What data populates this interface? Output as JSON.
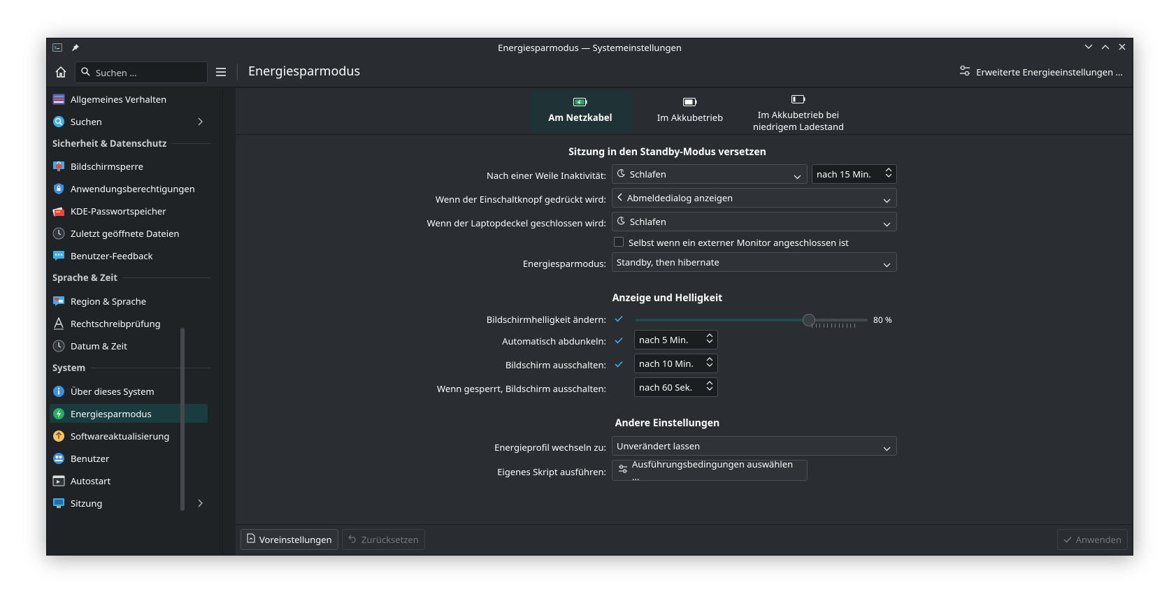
{
  "window": {
    "title": "Energiesparmodus — Systemeinstellungen"
  },
  "header": {
    "search_placeholder": "Suchen ...",
    "page_title": "Energiesparmodus",
    "advanced_button": "Erweiterte Energieeinstellungen ..."
  },
  "sidebar": {
    "items_top": [
      {
        "label": "Allgemeines Verhalten",
        "icon": "general-behavior-icon"
      },
      {
        "label": "Suchen",
        "icon": "search-icon"
      }
    ],
    "sections": [
      {
        "title": "Sicherheit & Datenschutz",
        "items": [
          {
            "label": "Bildschirmsperre",
            "icon": "screen-lock-icon"
          },
          {
            "label": "Anwendungsberechtigungen",
            "icon": "shield-icon"
          },
          {
            "label": "KDE-Passwortspeicher",
            "icon": "wallet-icon"
          },
          {
            "label": "Zuletzt geöffnete Dateien",
            "icon": "clock-icon"
          },
          {
            "label": "Benutzer-Feedback",
            "icon": "feedback-icon"
          }
        ]
      },
      {
        "title": "Sprache & Zeit",
        "items": [
          {
            "label": "Region & Sprache",
            "icon": "region-icon"
          },
          {
            "label": "Rechtschreibprüfung",
            "icon": "spellcheck-icon"
          },
          {
            "label": "Datum & Zeit",
            "icon": "clock-icon"
          }
        ]
      },
      {
        "title": "System",
        "items": [
          {
            "label": "Über dieses System",
            "icon": "info-icon"
          },
          {
            "label": "Energiesparmodus",
            "icon": "power-icon"
          },
          {
            "label": "Softwareaktualisierung",
            "icon": "update-icon"
          },
          {
            "label": "Benutzer",
            "icon": "users-icon"
          },
          {
            "label": "Autostart",
            "icon": "autostart-icon"
          },
          {
            "label": "Sitzung",
            "icon": "session-icon"
          }
        ]
      }
    ]
  },
  "tabs": [
    {
      "label": "Am Netzkabel",
      "active": true
    },
    {
      "label": "Im Akkubetrieb",
      "active": false
    },
    {
      "label": "Im Akkubetrieb bei niedrigem Ladestand",
      "active": false
    }
  ],
  "standby": {
    "title": "Sitzung in den Standby-Modus versetzen",
    "inactivity_label": "Nach einer Weile Inaktivität:",
    "inactivity_value": "Schlafen",
    "inactivity_time": "nach 15 Min.",
    "power_button_label": "Wenn der Einschaltknopf gedrückt wird:",
    "power_button_value": "Abmeldedialog anzeigen",
    "lid_label": "Wenn der Laptopdeckel geschlossen wird:",
    "lid_value": "Schlafen",
    "external_monitor_label": "Selbst wenn ein externer Monitor angeschlossen ist",
    "mode_label": "Energiesparmodus:",
    "mode_value": "Standby, then hibernate"
  },
  "display": {
    "title": "Anzeige und Helligkeit",
    "brightness_label": "Bildschirmhelligkeit ändern:",
    "brightness_value": "80 %",
    "brightness_fraction": 0.8,
    "dim_label": "Automatisch abdunkeln:",
    "dim_value": "nach 5 Min.",
    "off_label": "Bildschirm ausschalten:",
    "off_value": "nach 10 Min.",
    "locked_label": "Wenn gesperrt, Bildschirm ausschalten:",
    "locked_value": "nach 60 Sek."
  },
  "other": {
    "title": "Andere Einstellungen",
    "profile_label": "Energieprofil wechseln zu:",
    "profile_value": "Unverändert lassen",
    "script_label": "Eigenes Skript ausführen:",
    "script_button": "Ausführungsbedingungen auswählen ..."
  },
  "footer": {
    "defaults": "Voreinstellungen",
    "reset": "Zurücksetzen",
    "apply": "Anwenden"
  },
  "colors": {
    "accent": "#3daee9",
    "active_bg": "#1b3c3f",
    "window_bg": "#202326"
  }
}
